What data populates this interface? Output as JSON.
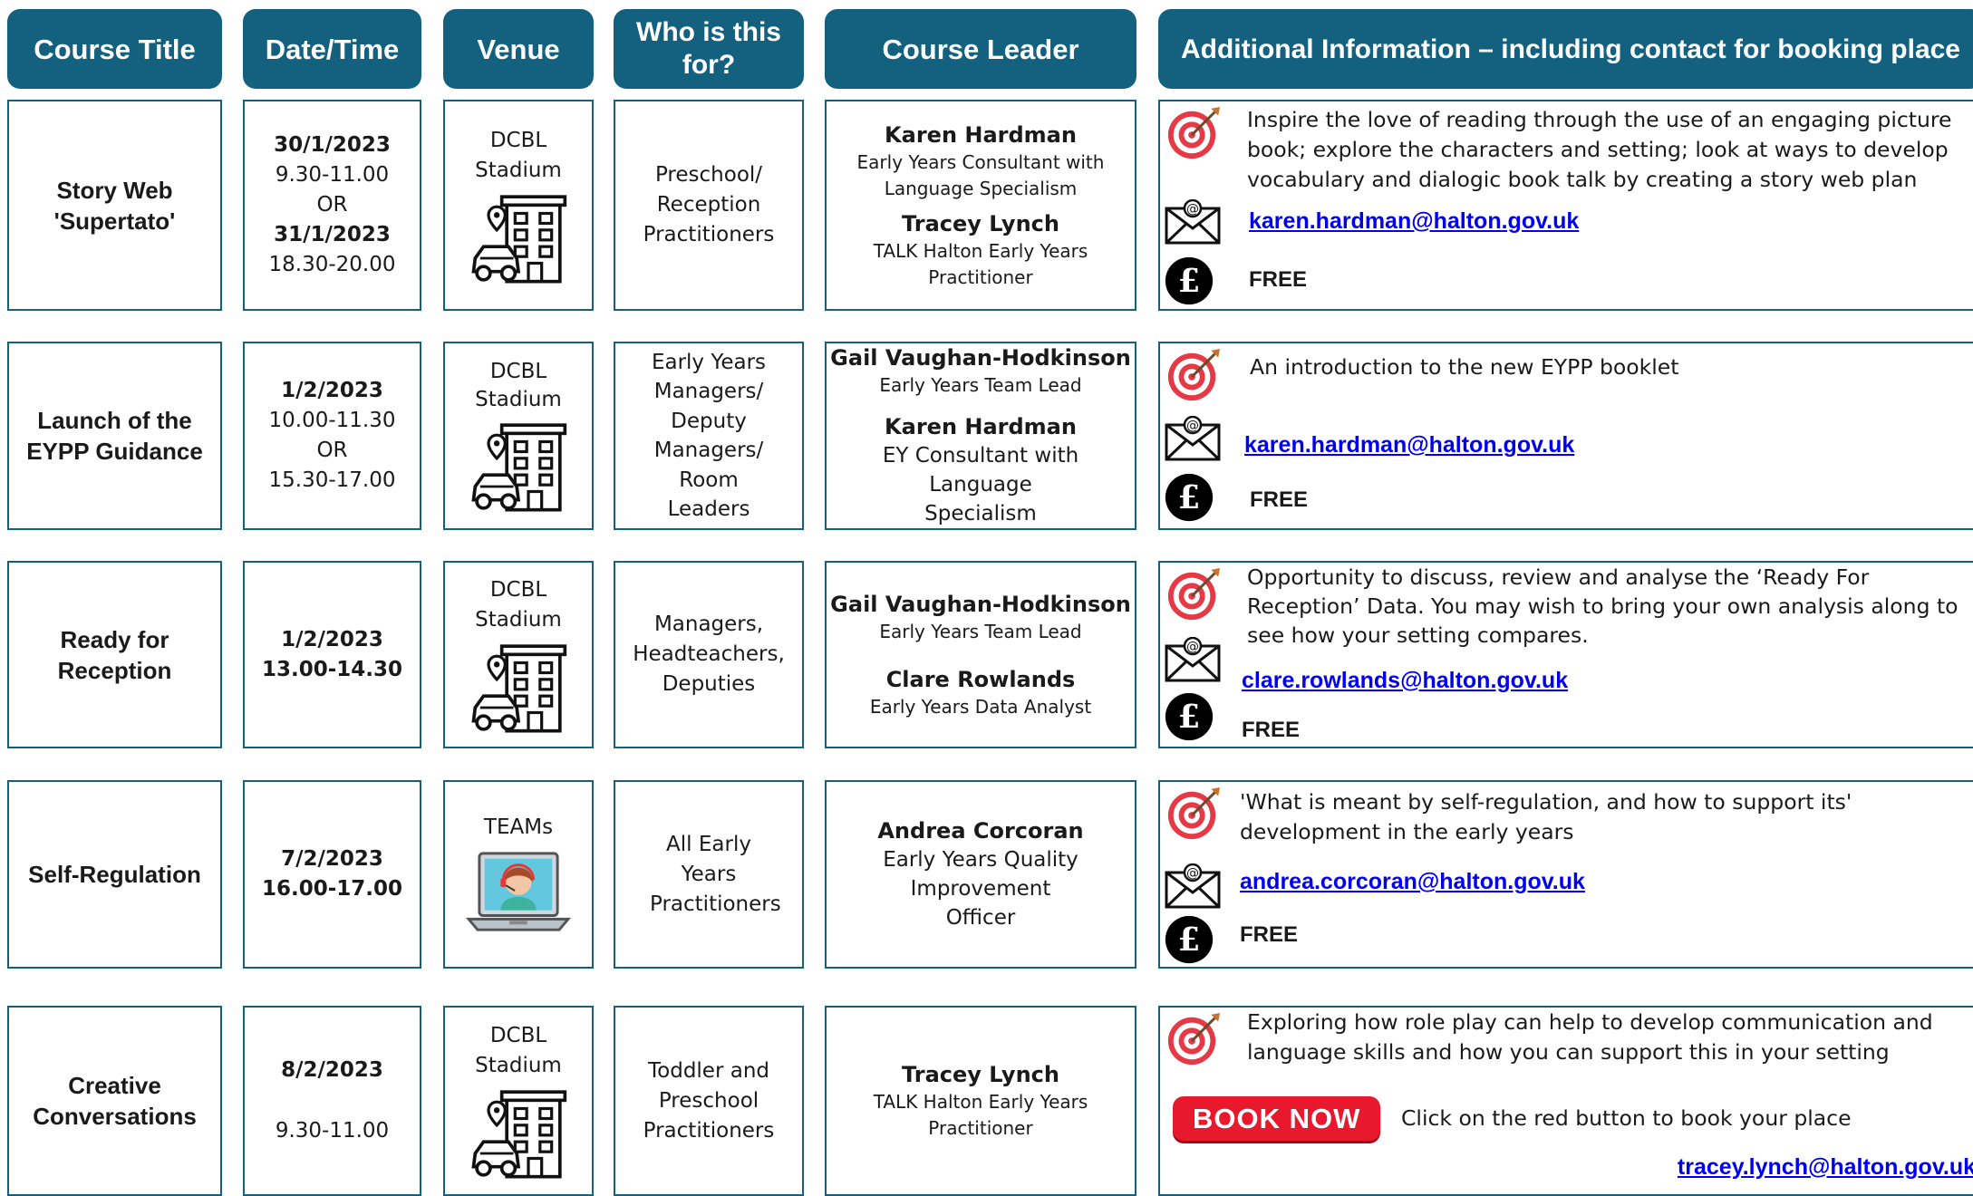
{
  "headers": {
    "course_title": "Course Title",
    "date_time": "Date/Time",
    "venue": "Venue",
    "who": "Who is this for?",
    "leader": "Course Leader",
    "additional": "Additional Information – including contact for booking place"
  },
  "icons": {
    "target": "target-icon",
    "email": "email-icon",
    "price": "pound-icon",
    "venue_stadium": "building-car-icon",
    "venue_teams": "video-call-icon"
  },
  "colors": {
    "header_bg": "#14617f",
    "border": "#14617f",
    "link": "#0000ee",
    "book_button": "#e8192c"
  },
  "courses": [
    {
      "title": "Story Web 'Supertato'",
      "date1": "30/1/2023",
      "time1": "9.30-11.00",
      "or": "OR",
      "date2": "31/1/2023",
      "time2": "18.30-20.00",
      "venue": "DCBL Stadium",
      "who": "Preschool/ Reception Practitioners",
      "leader1_name": "Karen Hardman",
      "leader1_role": "Early Years Consultant with Language Specialism",
      "leader2_name": "Tracey Lynch",
      "leader2_role": "TALK Halton Early Years Practitioner",
      "info": "Inspire the love of reading through the use of an engaging picture book; explore the characters and setting; look at ways to develop vocabulary and dialogic book talk by creating a story web plan",
      "email": "karen.hardman@halton.gov.uk",
      "price": "FREE"
    },
    {
      "title": "Launch of the EYPP Guidance",
      "date1": "1/2/2023",
      "time1": "10.00-11.30",
      "or": "OR",
      "time2": "15.30-17.00",
      "venue": "DCBL Stadium",
      "who": "Early Years Managers/ Deputy Managers/ Room Leaders",
      "leader1_name": "Gail Vaughan-Hodkinson",
      "leader1_role": "Early Years Team Lead",
      "leader2_name": "Karen Hardman",
      "leader2_role": "EY Consultant with Language Specialism",
      "info": "An introduction to the new EYPP booklet",
      "email": "karen.hardman@halton.gov.uk",
      "price": "FREE"
    },
    {
      "title": "Ready for Reception",
      "date1": "1/2/2023",
      "time1": "13.00-14.30",
      "venue": "DCBL Stadium",
      "who": "Managers, Headteachers, Deputies",
      "leader1_name": "Gail Vaughan-Hodkinson",
      "leader1_role": "Early Years Team Lead",
      "leader2_name": "Clare Rowlands",
      "leader2_role": "Early Years Data Analyst",
      "info": "Opportunity to discuss, review and analyse the ‘Ready For Reception’ Data.  You may wish to bring your own analysis along to see how your setting compares.",
      "email": "clare.rowlands@halton.gov.uk",
      "price": "FREE"
    },
    {
      "title": "Self-Regulation",
      "date1": "7/2/2023",
      "time1": "16.00-17.00",
      "venue": "TEAMs",
      "who": "All Early Years Practitioners",
      "leader1_name": "Andrea Corcoran",
      "leader1_role": "Early Years Quality Improvement Officer",
      "info": "'What is meant by self-regulation, and how to support its' development in the early years",
      "email": "andrea.corcoran@halton.gov.uk",
      "price": "FREE"
    },
    {
      "title": "Creative Conversations",
      "date1": "8/2/2023",
      "time1": "9.30-11.00",
      "venue": "DCBL Stadium",
      "who": "Toddler and Preschool Practitioners",
      "leader1_name": "Tracey Lynch",
      "leader1_role": "TALK Halton Early Years Practitioner",
      "info": "Exploring how role play can help to develop  communication and language skills and how you can support this in your setting",
      "book_label": "BOOK NOW",
      "book_hint": "Click on the red button to book your place",
      "email": "tracey.lynch@halton.gov.uk"
    }
  ]
}
